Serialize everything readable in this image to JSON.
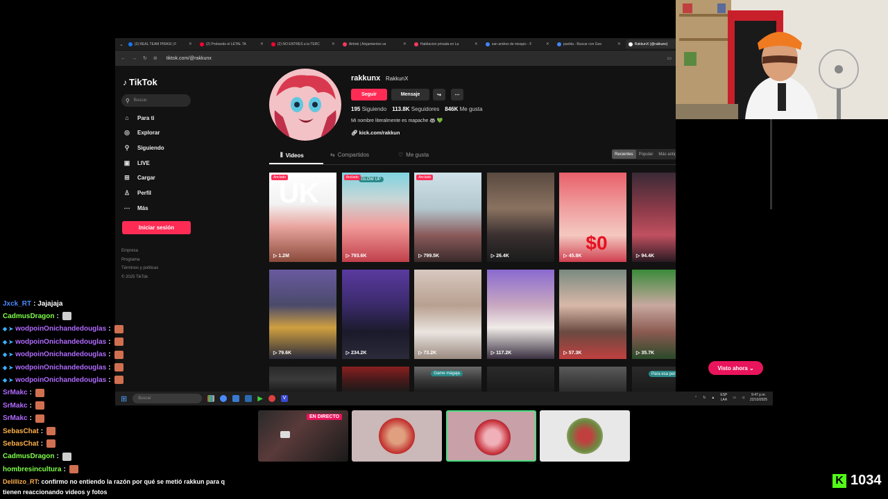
{
  "browser": {
    "tabs": [
      {
        "label": "(3) REAL TEAM PIRASI | F",
        "color": "#1877f2",
        "active": false
      },
      {
        "label": "(2) Probando el LETAL TA",
        "color": "#ff0033",
        "active": false
      },
      {
        "label": "(2) NO ENTRES a la TERC",
        "color": "#ff0033",
        "active": false
      },
      {
        "label": "Airbnb | Alojamientos va",
        "color": "#ff385c",
        "active": false
      },
      {
        "label": "Habitacion privada en La",
        "color": "#ff385c",
        "active": false
      },
      {
        "label": "san andres de misquic - F",
        "color": "#4285f4",
        "active": false
      },
      {
        "label": "puebla - Buscar con Goo",
        "color": "#4285f4",
        "active": false
      },
      {
        "label": "RakkunX (@rakkunx)",
        "color": "#ffffff",
        "active": true
      }
    ],
    "url": "tiktok.com/@rakkunx"
  },
  "tiktok": {
    "logo": "TikTok",
    "search_placeholder": "Buscar",
    "nav": [
      {
        "label": "Para ti",
        "icon": "home-icon",
        "glyph": "⌂"
      },
      {
        "label": "Explorar",
        "icon": "compass-icon",
        "glyph": "◎"
      },
      {
        "label": "Siguiendo",
        "icon": "user-follow-icon",
        "glyph": "⚲"
      },
      {
        "label": "LIVE",
        "icon": "live-icon",
        "glyph": "▣"
      },
      {
        "label": "Cargar",
        "icon": "upload-icon",
        "glyph": "⊞"
      },
      {
        "label": "Perfil",
        "icon": "profile-icon",
        "glyph": "♙"
      },
      {
        "label": "Más",
        "icon": "more-icon",
        "glyph": "⋯"
      }
    ],
    "login_label": "Iniciar sesión",
    "footer": [
      "Empresa",
      "Programa",
      "Términos y políticas",
      "© 2025 TikTok"
    ]
  },
  "profile": {
    "username": "rakkunx",
    "nickname": "RakkunX",
    "follow_label": "Seguir",
    "message_label": "Mensaje",
    "following_count": "195",
    "following_label": "Siguiendo",
    "followers_count": "113.8K",
    "followers_label": "Seguidores",
    "likes_count": "846K",
    "likes_label": "Me gusta",
    "bio": "Mi nombre literalmente es mapache 🦝 💚",
    "link": "kick.com/rakkun"
  },
  "content_tabs": [
    "Videos",
    "Compartidos",
    "Me gusta"
  ],
  "sort_options": [
    "Recientes",
    "Popular",
    "Más antiguos"
  ],
  "videos": [
    {
      "views": "1.2M",
      "pinned": true,
      "bg": "linear-gradient(180deg,#ffffff 0%,#f2f2f2 35%,#e9a6a0 60%,#8a4a3a 100%)",
      "overlay": "UK"
    },
    {
      "views": "793.6K",
      "pinned": true,
      "bg": "linear-gradient(180deg,#7fd3e0 0%,#c9d6d6 30%,#f29a9a 60%,#c0404a 100%)",
      "overlay": "GLOW UP"
    },
    {
      "views": "799.5K",
      "pinned": true,
      "bg": "linear-gradient(180deg,#cfe0e8 0%,#b4c8d0 40%,#8a5a5a 70%,#3a2a2a 100%)",
      "overlay": ""
    },
    {
      "views": "26.4K",
      "pinned": false,
      "bg": "linear-gradient(180deg,#5a4a40 0%,#8a7260 40%,#3a3030 70%,#1a1a1a 100%)",
      "overlay": ""
    },
    {
      "views": "45.8K",
      "pinned": false,
      "bg": "linear-gradient(180deg,#e8606a 0%,#f0a0a0 40%,#f4c8c0 70%,#d04050 100%)",
      "overlay": "$0"
    },
    {
      "views": "94.4K",
      "pinned": false,
      "bg": "linear-gradient(180deg,#3a2a36 0%,#8a3a48 40%,#c05060 70%,#2a1a22 100%)",
      "overlay": ""
    },
    {
      "views": "79.6K",
      "pinned": false,
      "bg": "linear-gradient(180deg,#6a5aa0 0%,#4a4a6a 40%,#d0a040 65%,#2a2a3a 100%)",
      "overlay": ""
    },
    {
      "views": "234.2K",
      "pinned": false,
      "bg": "linear-gradient(180deg,#5a3aa0 0%,#3a2a6a 40%,#1a1a2a 70%,#2a2a3a 100%)",
      "overlay": ""
    },
    {
      "views": "73.2K",
      "pinned": false,
      "bg": "linear-gradient(180deg,#d8c8c0 0%,#b8a090 40%,#eae4e0 70%,#9a8a80 100%)",
      "overlay": ""
    },
    {
      "views": "117.2K",
      "pinned": false,
      "bg": "linear-gradient(180deg,#8a6ad0 0%,#c8a8c0 40%,#f0ece8 65%,#3a3040 100%)",
      "overlay": ""
    },
    {
      "views": "57.3K",
      "pinned": false,
      "bg": "linear-gradient(180deg,#7a8a80 0%,#d8b8a8 40%,#6a4a40 70%,#c04040 100%)",
      "overlay": ""
    },
    {
      "views": "35.7K",
      "pinned": false,
      "bg": "linear-gradient(180deg,#3a8a3a 0%,#c8a8a0 40%,#8a5a50 70%,#2a4a2a 100%)",
      "overlay": ""
    },
    {
      "views": "",
      "pinned": false,
      "bg": "linear-gradient(180deg,#2a2a2a 0%,#3a3a3a 50%,#1a1a1a 100%)",
      "overlay": ""
    },
    {
      "views": "",
      "pinned": false,
      "bg": "linear-gradient(180deg,#8a2020 0%,#4a1a1a 50%,#1a1a1a 100%)",
      "overlay": ""
    },
    {
      "views": "",
      "pinned": false,
      "bg": "linear-gradient(180deg,#6a6a6a 0%,#3a3a3a 50%,#1a1a1a 100%)",
      "overlay": "Game mágaja"
    },
    {
      "views": "",
      "pinned": false,
      "bg": "linear-gradient(180deg,#2a2a2a 0%,#1a1a1a 100%)",
      "overlay": ""
    },
    {
      "views": "",
      "pinned": false,
      "bg": "linear-gradient(180deg,#5a5a5a 0%,#2a2a2a 100%)",
      "overlay": ""
    },
    {
      "views": "",
      "pinned": false,
      "bg": "linear-gradient(180deg,#2a2a2a 0%,#1a1a1a 100%)",
      "overlay": "Para esa persona 😀"
    }
  ],
  "taskbar": {
    "search_placeholder": "Buscar",
    "lang_top": "ESP",
    "lang_bottom": "LAA",
    "time": "9:47 p.m.",
    "date": "22/10/2025"
  },
  "visto_label": "Visto ahora ⌄",
  "live_badge": "EN DIRECTO",
  "chat": [
    {
      "user": "Jxck_RT",
      "text": ": Jajajaja",
      "color": "#4a8aff",
      "badges": "",
      "emote": ""
    },
    {
      "user": "CadmusDragon",
      "text": ":",
      "color": "#7fff4a",
      "badges": "",
      "emote": "#cfcfcf"
    },
    {
      "user": "wodpoinOnichandedouglas",
      "text": ":",
      "color": "#b06aff",
      "badges": "◆ ➤",
      "emote": "#d07050"
    },
    {
      "user": "wodpoinOnichandedouglas",
      "text": ":",
      "color": "#b06aff",
      "badges": "◆ ➤",
      "emote": "#d07050"
    },
    {
      "user": "wodpoinOnichandedouglas",
      "text": ":",
      "color": "#b06aff",
      "badges": "◆ ➤",
      "emote": "#d07050"
    },
    {
      "user": "wodpoinOnichandedouglas",
      "text": ":",
      "color": "#b06aff",
      "badges": "◆ ➤",
      "emote": "#d07050"
    },
    {
      "user": "wodpoinOnichandedouglas",
      "text": ":",
      "color": "#b06aff",
      "badges": "◆ ➤",
      "emote": "#d07050"
    },
    {
      "user": "SrMakc",
      "text": ":",
      "color": "#b06aff",
      "badges": "",
      "emote": "#d07050"
    },
    {
      "user": "SrMakc",
      "text": ":",
      "color": "#b06aff",
      "badges": "",
      "emote": "#d07050"
    },
    {
      "user": "SrMakc",
      "text": ":",
      "color": "#b06aff",
      "badges": "",
      "emote": "#d07050"
    },
    {
      "user": "SebasChat",
      "text": ":",
      "color": "#ffb04a",
      "badges": "",
      "emote": "#d07050"
    },
    {
      "user": "SebasChat",
      "text": ":",
      "color": "#ffb04a",
      "badges": "",
      "emote": "#d07050"
    },
    {
      "user": "CadmusDragon",
      "text": ":",
      "color": "#7fff4a",
      "badges": "",
      "emote": "#cfcfcf"
    },
    {
      "user": "hombresincultura",
      "text": ":",
      "color": "#7fff4a",
      "badges": "",
      "emote": "#d07050"
    }
  ],
  "chat_last": {
    "user": "Delillizo_RT",
    "text": ": confirmo no entiendo la razón por qué se metió rakkun para q",
    "text2": "tienen reaccionando videos y fotos"
  },
  "viewer_count": "1034",
  "accent": "#fe2c55"
}
